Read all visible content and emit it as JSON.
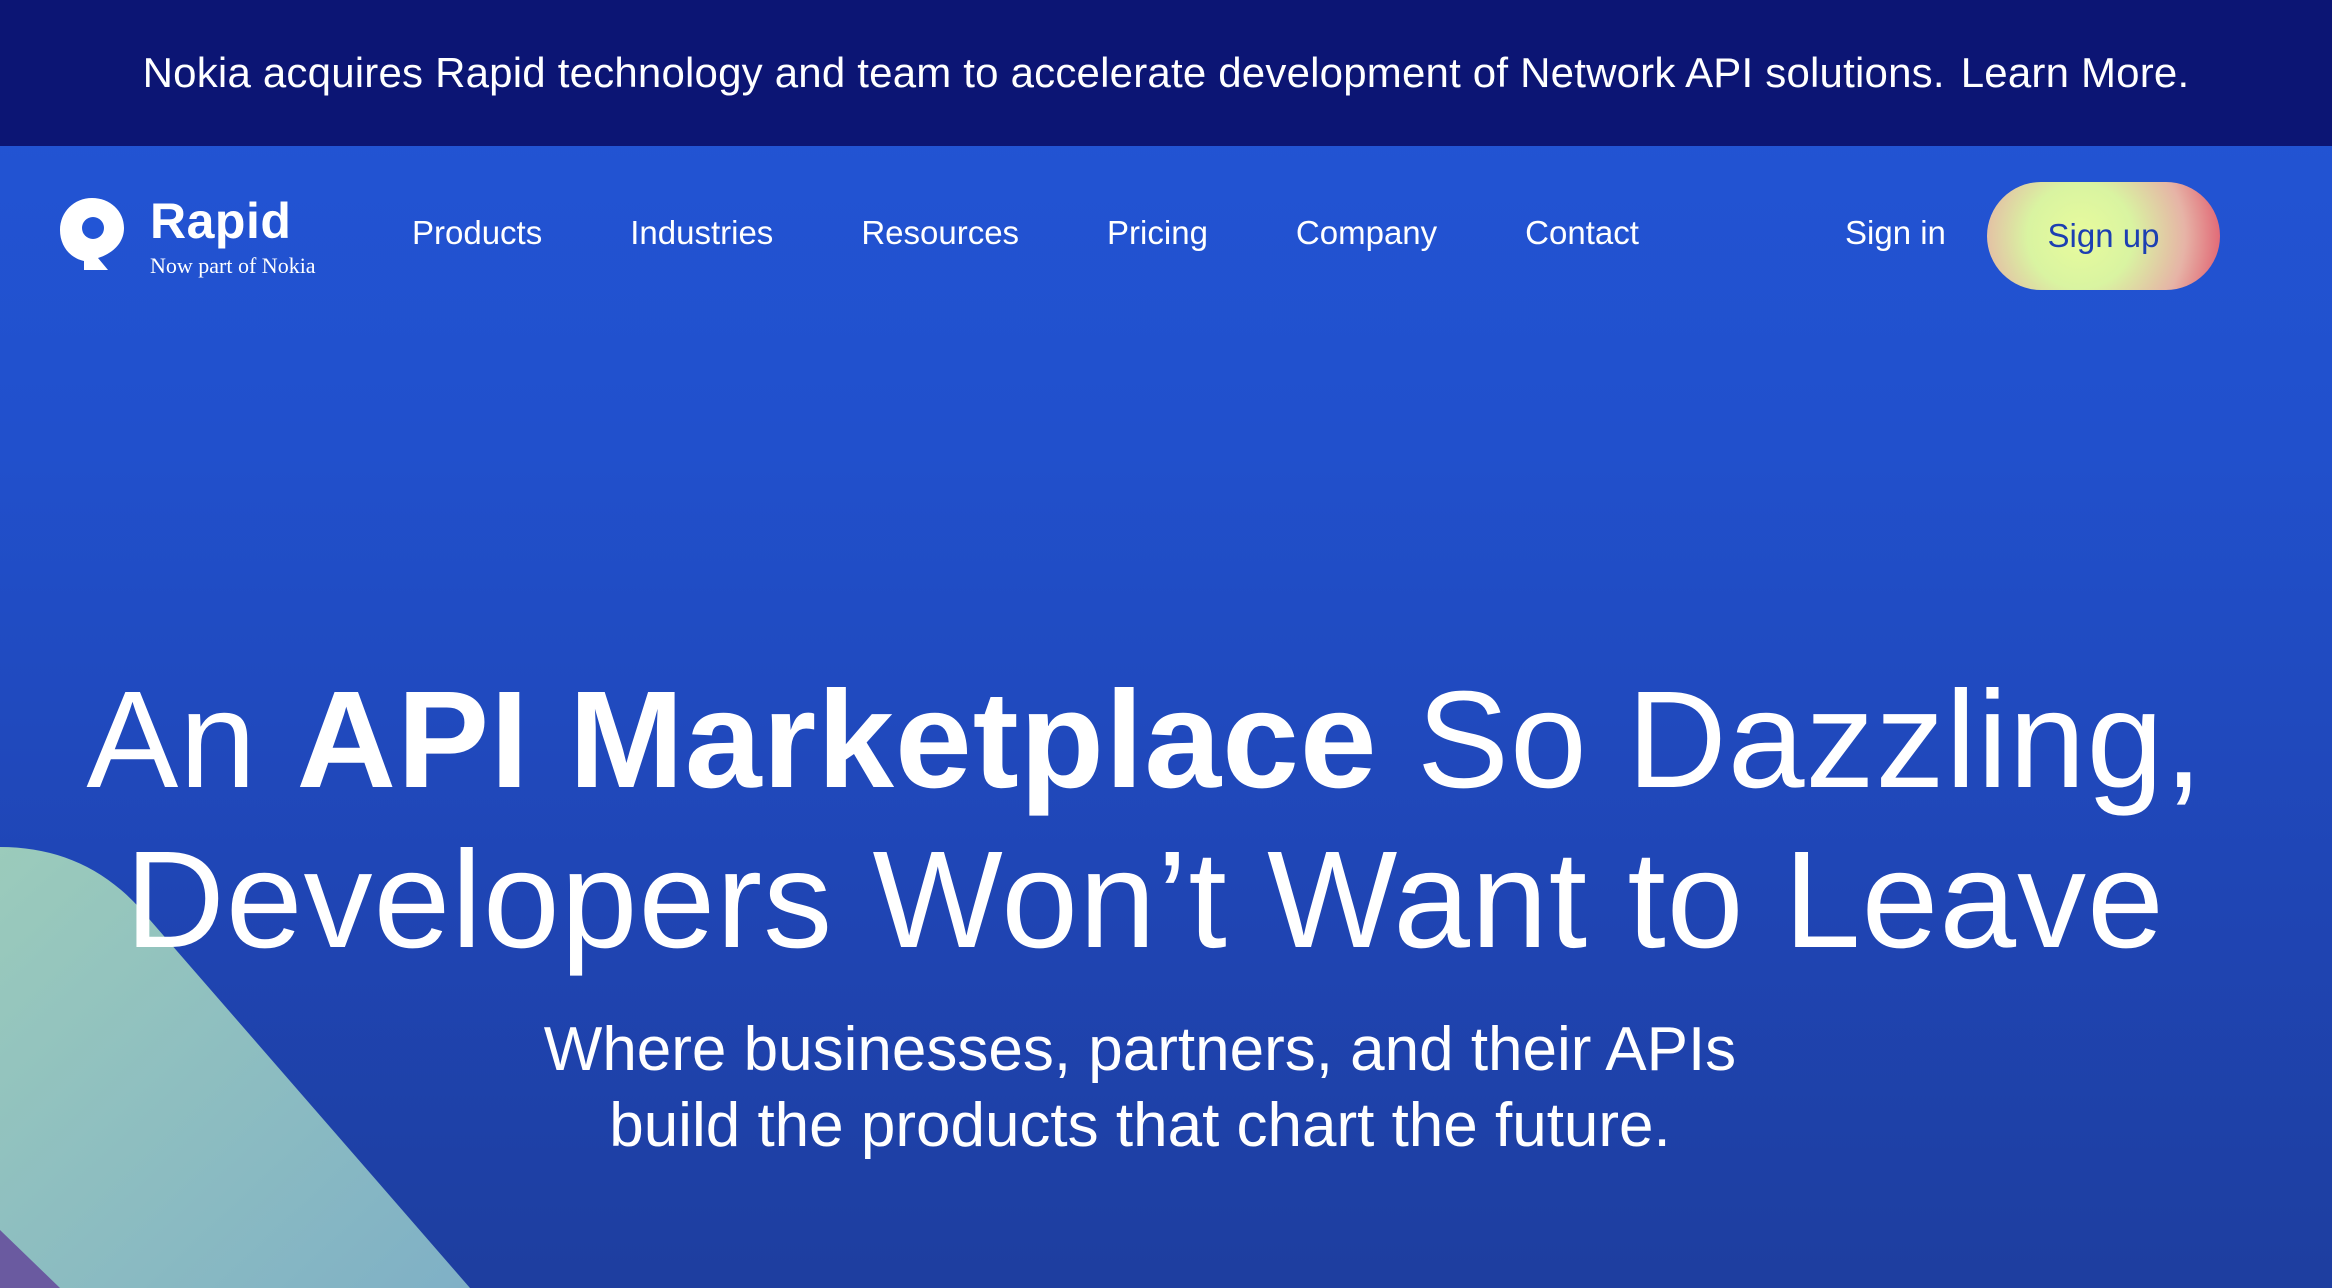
{
  "announcement": {
    "text": "Nokia acquires Rapid technology and team to accelerate development of Network API solutions.",
    "link": "Learn More."
  },
  "brand": {
    "name": "Rapid",
    "tagline": "Now part of Nokia",
    "icon": "rapid-r-logo-icon"
  },
  "nav": {
    "items": [
      "Products",
      "Industries",
      "Resources",
      "Pricing",
      "Company",
      "Contact"
    ],
    "sign_in": "Sign in",
    "sign_up": "Sign up"
  },
  "hero": {
    "line1_prefix": "An ",
    "line1_bold": "API Marketplace",
    "line1_suffix": " So Dazzling,",
    "line2": "Developers Won’t Want to Leave",
    "subhead": "Where businesses, partners, and their APIs build the products that chart the future."
  },
  "colors": {
    "announcement_bg": "#0c1574",
    "hero_bg": "#2255d6",
    "signup_text": "#1c3fb2",
    "decor_shape": "#8fc3c0"
  }
}
